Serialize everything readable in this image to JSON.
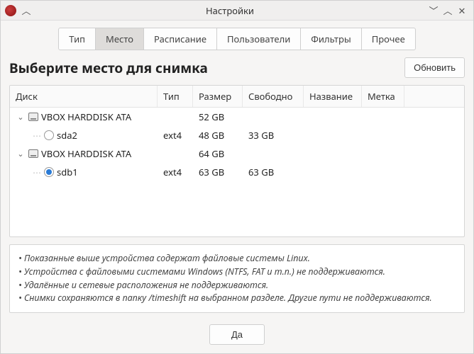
{
  "window": {
    "title": "Настройки"
  },
  "tabs": [
    {
      "label": "Тип",
      "active": false
    },
    {
      "label": "Место",
      "active": true
    },
    {
      "label": "Расписание",
      "active": false
    },
    {
      "label": "Пользователи",
      "active": false
    },
    {
      "label": "Фильтры",
      "active": false
    },
    {
      "label": "Прочее",
      "active": false
    }
  ],
  "heading": "Выберите место для снимка",
  "refresh_label": "Обновить",
  "columns": {
    "disk": "Диск",
    "type": "Тип",
    "size": "Размер",
    "free": "Свободно",
    "name": "Название",
    "label": "Метка"
  },
  "rows": [
    {
      "kind": "parent",
      "expanded": true,
      "disk": "VBOX HARDDISK ATA",
      "type": "",
      "size": "52 GB",
      "free": ""
    },
    {
      "kind": "child",
      "selected": false,
      "disk": "sda2",
      "type": "ext4",
      "size": "48 GB",
      "free": "33 GB"
    },
    {
      "kind": "parent",
      "expanded": true,
      "disk": "VBOX HARDDISK ATA",
      "type": "",
      "size": "64 GB",
      "free": ""
    },
    {
      "kind": "child",
      "selected": true,
      "disk": "sdb1",
      "type": "ext4",
      "size": "63 GB",
      "free": "63 GB"
    }
  ],
  "notes": [
    "Показанные выше устройства содержат файловые системы Linux.",
    "Устройства с файловыми системами Windows (NTFS, FAT и т.п.) не поддерживаются.",
    "Удалённые и сетевые расположения не поддерживаются.",
    "Снимки сохраняются в папку /timeshift на выбранном разделе. Другие пути не поддерживаются."
  ],
  "ok_label": "Да"
}
